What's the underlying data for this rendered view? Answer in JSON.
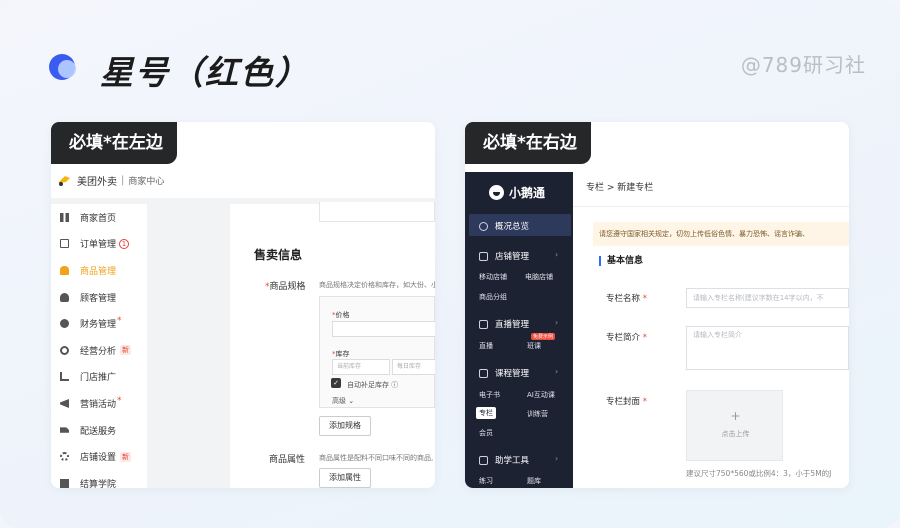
{
  "slide": {
    "title": "星号（红色）",
    "brand": "@789研习社"
  },
  "left_card": {
    "tag": "必填*在左边",
    "header": {
      "brand": "美团外卖",
      "separator": "|",
      "center": "商家中心"
    },
    "nav": [
      {
        "label": "商家首页",
        "icon": "grid-icon"
      },
      {
        "label": "订单管理",
        "icon": "order-icon",
        "badge_circle": "1"
      },
      {
        "label": "商品管理",
        "icon": "goods-icon",
        "active": true
      },
      {
        "label": "顾客管理",
        "icon": "user-icon"
      },
      {
        "label": "财务管理",
        "icon": "finance-icon",
        "dot": "*"
      },
      {
        "label": "经营分析",
        "icon": "analysis-icon",
        "badge": "新"
      },
      {
        "label": "门店推广",
        "icon": "promo-icon"
      },
      {
        "label": "营销活动",
        "icon": "marketing-icon",
        "dot": "*"
      },
      {
        "label": "配送服务",
        "icon": "delivery-icon"
      },
      {
        "label": "店铺设置",
        "icon": "settings-icon",
        "badge": "新"
      },
      {
        "label": "结算学院",
        "icon": "school-icon"
      }
    ],
    "section_title": "售卖信息",
    "spec_label": "商品规格",
    "spec_hint": "商品规格决定价格和库存，如大份、小",
    "price_label": "价格",
    "stock_label": "库存",
    "stock_current_placeholder": "当前库存",
    "stock_daily_placeholder": "每日库存",
    "auto_restock": "自动补足库存 ⓘ",
    "advanced": "高级 ⌄",
    "add_spec_button": "添加规格",
    "attr_label": "商品属性",
    "attr_hint": "商品属性是配料不同口味不同的商品,",
    "add_attr_button": "添加属性",
    "star": "*",
    "accent_color": "#f2a21b",
    "required_color": "#e6453a"
  },
  "right_card": {
    "tag": "必填*在右边",
    "logo": "小鹅通",
    "menu": {
      "overview": "概况总览",
      "store_mgmt": "店铺管理",
      "store_subs": [
        "移动店铺",
        "电脑店铺",
        "商品分组"
      ],
      "live_mgmt": "直播管理",
      "live_subs": [
        "直播",
        "班课"
      ],
      "hot_badge": "免费示例",
      "course_mgmt": "课程管理",
      "course_subs": [
        "电子书",
        "AI互动课",
        "专栏",
        "训练营",
        "会员"
      ],
      "study_tools": "助学工具",
      "study_subs": [
        "练习",
        "题库"
      ]
    },
    "breadcrumb": "专栏 > 新建专栏",
    "notice": "请您遵守国家相关规定，切勿上传低俗色情、暴力恐怖、谣言诈骗、",
    "section": "基本信息",
    "name_label": "专栏名称",
    "name_placeholder": "请输入专栏名称(建议字数在14字以内，不",
    "intro_label": "专栏简介",
    "intro_placeholder": "请输入专栏简介",
    "cover_label": "专栏封面",
    "upload_plus": "+",
    "upload_text": "点击上传",
    "upload_hint": "建议尺寸750*560或比例4：3，小于5M的J",
    "star": "*",
    "sidebar_color": "#1d2233",
    "section_accent": "#2a6df4"
  }
}
